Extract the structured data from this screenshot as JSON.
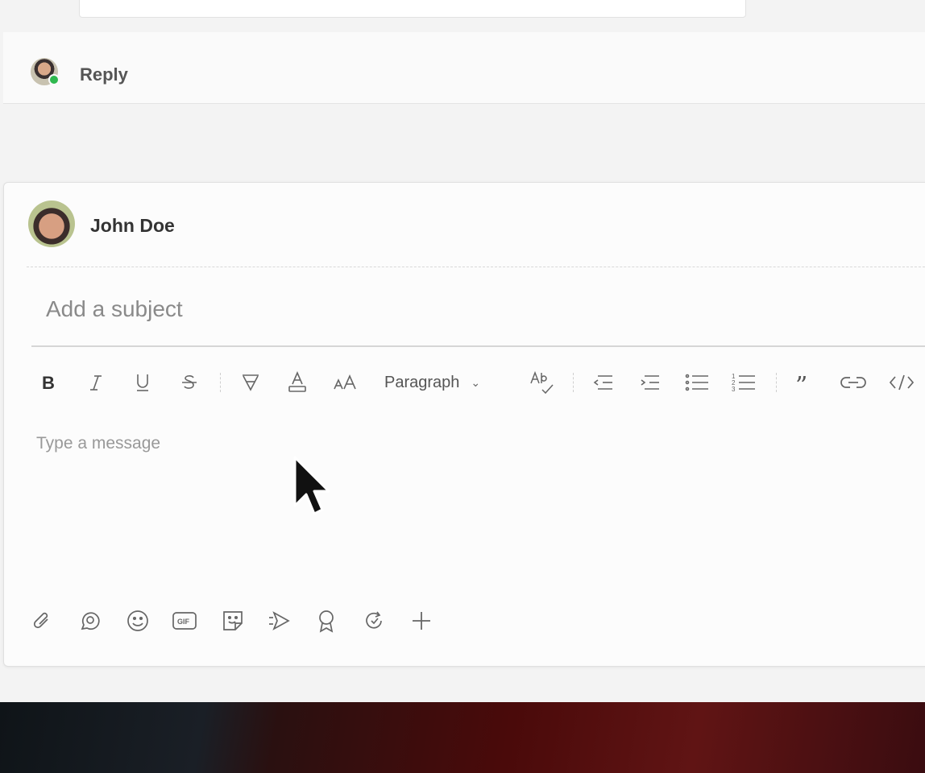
{
  "thread": {
    "reply_label": "Reply"
  },
  "composer": {
    "author_name": "John Doe",
    "subject_placeholder": "Add a subject",
    "message_placeholder": "Type a message",
    "paragraph_label": "Paragraph",
    "toolbar_icons": [
      "bold-icon",
      "italic-icon",
      "underline-icon",
      "strikethrough-icon",
      "highlight-icon",
      "font-color-icon",
      "font-size-icon",
      "paragraph-style-dropdown",
      "spellcheck-icon",
      "decrease-indent-icon",
      "increase-indent-icon",
      "bulleted-list-icon",
      "numbered-list-icon",
      "quote-icon",
      "link-icon",
      "code-icon"
    ],
    "bottom_icons": [
      "attach-icon",
      "loop-icon",
      "emoji-icon",
      "gif-icon",
      "sticker-icon",
      "send-later-icon",
      "praise-icon",
      "update-icon",
      "add-icon"
    ]
  },
  "colors": {
    "presence": "#2fb84f",
    "icon": "#555555",
    "placeholder": "#8a8a8a"
  }
}
